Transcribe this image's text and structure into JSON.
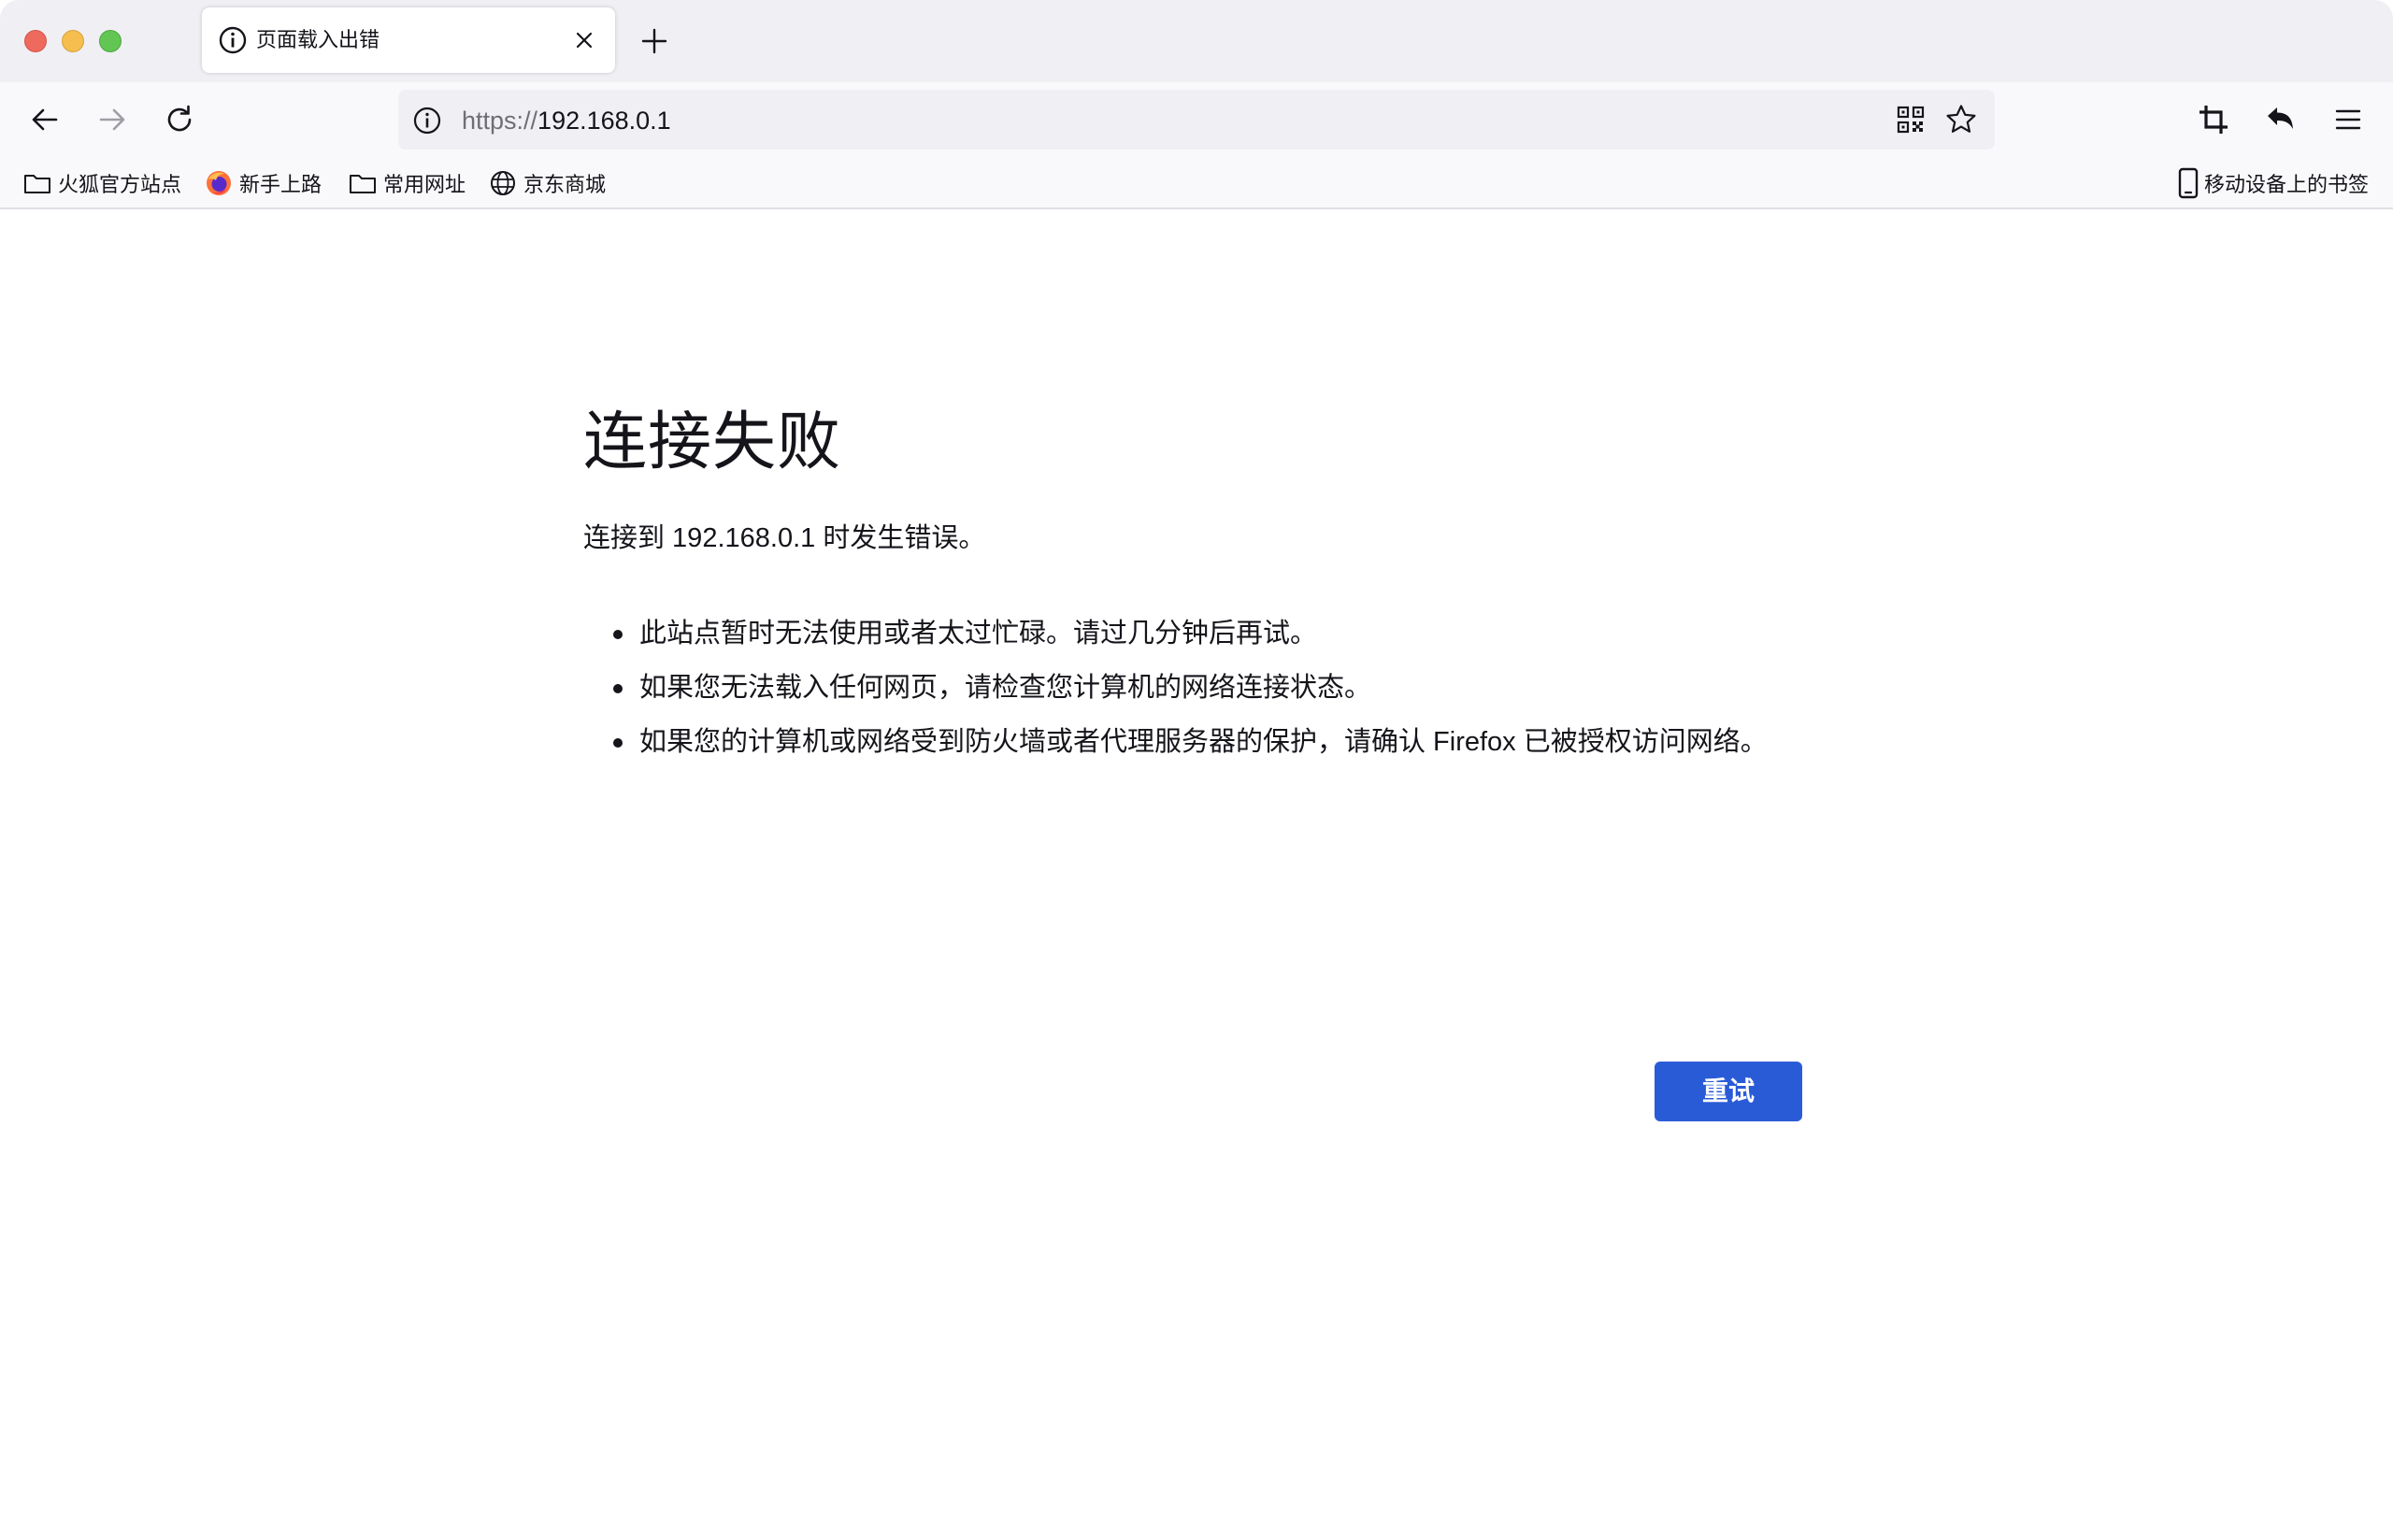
{
  "window": {
    "traffic_lights": {
      "close": "#ee6a5f",
      "minimize": "#f5be4f",
      "maximize": "#62c554"
    }
  },
  "tabs": {
    "active": {
      "title": "页面载入出错",
      "icon": "info-icon"
    },
    "new_tab_icon": "plus-icon"
  },
  "toolbar": {
    "back_icon": "arrow-left-icon",
    "forward_icon": "arrow-right-icon",
    "reload_icon": "reload-icon",
    "url": {
      "scheme": "https://",
      "host": "192.168.0.1"
    },
    "right_icons": [
      "crop-icon",
      "undo-icon",
      "hamburger-menu-icon"
    ]
  },
  "bookmarks": {
    "items": [
      {
        "label": "火狐官方站点",
        "icon": "folder-icon"
      },
      {
        "label": "新手上路",
        "icon": "firefox-logo-icon"
      },
      {
        "label": "常用网址",
        "icon": "folder-icon"
      },
      {
        "label": "京东商城",
        "icon": "globe-icon"
      }
    ],
    "mobile": {
      "label": "移动设备上的书签",
      "icon": "mobile-device-icon"
    }
  },
  "error_page": {
    "title": "连接失败",
    "description": "连接到 192.168.0.1 时发生错误。",
    "suggestions": [
      "此站点暂时无法使用或者太过忙碌。请过几分钟后再试。",
      "如果您无法载入任何网页，请检查您计算机的网络连接状态。",
      "如果您的计算机或网络受到防火墙或者代理服务器的保护，请确认 Firefox 已被授权访问网络。"
    ],
    "retry_label": "重试",
    "accent_color": "#2a5bd7"
  }
}
